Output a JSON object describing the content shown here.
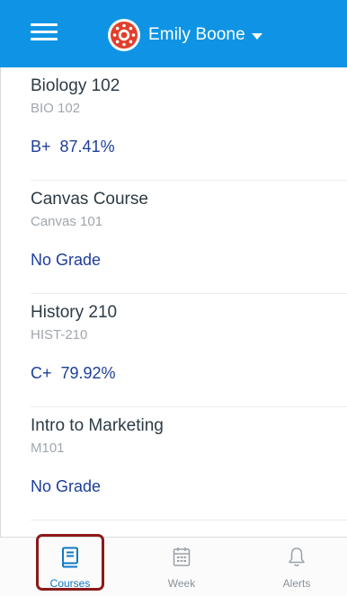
{
  "header": {
    "user_name": "Emily Boone",
    "menu_icon": "hamburger-menu-icon",
    "avatar_icon": "canvas-logo-icon",
    "caret_icon": "caret-down-icon",
    "accent_color": "#0f94e5"
  },
  "courses": [
    {
      "name": "Biology 102",
      "code": "BIO 102",
      "grade_letter": "B+",
      "grade_percent": "87.41%"
    },
    {
      "name": "Canvas Course",
      "code": "Canvas 101",
      "grade_letter": "No Grade",
      "grade_percent": ""
    },
    {
      "name": "History 210",
      "code": "HIST-210",
      "grade_letter": "C+",
      "grade_percent": "79.92%"
    },
    {
      "name": "Intro to Marketing",
      "code": "M101",
      "grade_letter": "No Grade",
      "grade_percent": ""
    }
  ],
  "tabs": [
    {
      "label": "Courses",
      "icon": "book-icon",
      "active": true
    },
    {
      "label": "Week",
      "icon": "calendar-icon",
      "active": false
    },
    {
      "label": "Alerts",
      "icon": "bell-icon",
      "active": false
    }
  ],
  "highlight_color": "#8b1a1a"
}
